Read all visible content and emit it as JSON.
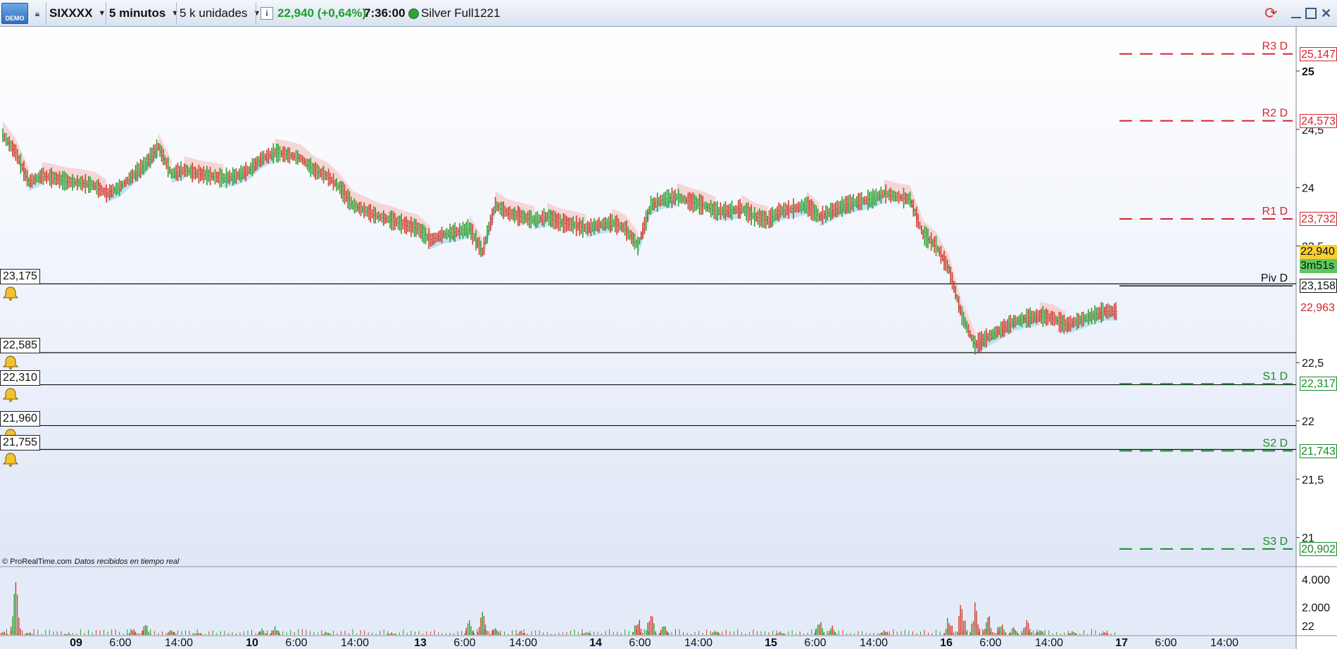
{
  "toolbar": {
    "demo_label": "DEMO",
    "symbol": "SIXXXX",
    "timeframe": "5 minutos",
    "units": "5 k unidades",
    "price_change": "22,940 (+0,64%)",
    "time": "7:36:00",
    "account": "Silver Full1221"
  },
  "chart_data": {
    "type": "line",
    "ylim": [
      20.75,
      25.38
    ],
    "x_tick_labels": [
      "09",
      "6:00",
      "14:00",
      "10",
      "6:00",
      "14:00",
      "13",
      "6:00",
      "14:00",
      "14",
      "6:00",
      "14:00",
      "15",
      "6:00",
      "14:00",
      "16",
      "6:00",
      "14:00",
      "17",
      "6:00",
      "14:00"
    ],
    "y_tick_labels": [
      25,
      24.5,
      24,
      23.5,
      22.5,
      22,
      21.5,
      21
    ],
    "y_tick_text": [
      "25",
      "24,5",
      "24",
      "23,5",
      "22,5",
      "22",
      "21,5",
      "21"
    ],
    "price_series": [
      [
        0,
        24.45
      ],
      [
        2,
        24.3
      ],
      [
        4,
        24.05
      ],
      [
        6,
        24.1
      ],
      [
        8,
        24.08
      ],
      [
        10,
        24.05
      ],
      [
        12,
        24.04
      ],
      [
        14,
        24.02
      ],
      [
        16,
        23.95
      ],
      [
        18,
        24.0
      ],
      [
        20,
        24.1
      ],
      [
        22,
        24.2
      ],
      [
        24,
        24.35
      ],
      [
        26,
        24.12
      ],
      [
        28,
        24.15
      ],
      [
        30,
        24.12
      ],
      [
        32,
        24.1
      ],
      [
        34,
        24.08
      ],
      [
        36,
        24.1
      ],
      [
        38,
        24.15
      ],
      [
        40,
        24.25
      ],
      [
        42,
        24.3
      ],
      [
        44,
        24.28
      ],
      [
        46,
        24.25
      ],
      [
        48,
        24.15
      ],
      [
        50,
        24.1
      ],
      [
        52,
        24.0
      ],
      [
        54,
        23.85
      ],
      [
        56,
        23.8
      ],
      [
        58,
        23.75
      ],
      [
        60,
        23.72
      ],
      [
        62,
        23.68
      ],
      [
        64,
        23.65
      ],
      [
        66,
        23.55
      ],
      [
        68,
        23.6
      ],
      [
        70,
        23.62
      ],
      [
        72,
        23.65
      ],
      [
        74,
        23.45
      ],
      [
        76,
        23.85
      ],
      [
        78,
        23.78
      ],
      [
        80,
        23.75
      ],
      [
        82,
        23.72
      ],
      [
        84,
        23.75
      ],
      [
        86,
        23.7
      ],
      [
        88,
        23.68
      ],
      [
        90,
        23.65
      ],
      [
        92,
        23.68
      ],
      [
        94,
        23.7
      ],
      [
        96,
        23.65
      ],
      [
        98,
        23.5
      ],
      [
        100,
        23.85
      ],
      [
        102,
        23.9
      ],
      [
        104,
        23.92
      ],
      [
        106,
        23.88
      ],
      [
        108,
        23.85
      ],
      [
        110,
        23.8
      ],
      [
        112,
        23.8
      ],
      [
        114,
        23.82
      ],
      [
        116,
        23.75
      ],
      [
        118,
        23.72
      ],
      [
        120,
        23.8
      ],
      [
        122,
        23.82
      ],
      [
        124,
        23.85
      ],
      [
        126,
        23.75
      ],
      [
        128,
        23.8
      ],
      [
        130,
        23.85
      ],
      [
        132,
        23.88
      ],
      [
        134,
        23.9
      ],
      [
        136,
        23.95
      ],
      [
        138,
        23.92
      ],
      [
        140,
        23.9
      ],
      [
        142,
        23.6
      ],
      [
        144,
        23.5
      ],
      [
        146,
        23.3
      ],
      [
        148,
        22.9
      ],
      [
        150,
        22.65
      ],
      [
        152,
        22.72
      ],
      [
        154,
        22.78
      ],
      [
        156,
        22.85
      ],
      [
        158,
        22.88
      ],
      [
        160,
        22.9
      ],
      [
        162,
        22.88
      ],
      [
        164,
        22.82
      ],
      [
        166,
        22.86
      ],
      [
        168,
        22.9
      ],
      [
        170,
        22.94
      ],
      [
        172,
        22.94
      ]
    ],
    "volume_series": [
      [
        0,
        300
      ],
      [
        2,
        3800
      ],
      [
        4,
        200
      ],
      [
        10,
        100
      ],
      [
        20,
        600
      ],
      [
        22,
        900
      ],
      [
        26,
        500
      ],
      [
        30,
        200
      ],
      [
        40,
        500
      ],
      [
        42,
        700
      ],
      [
        50,
        300
      ],
      [
        60,
        200
      ],
      [
        72,
        1100
      ],
      [
        74,
        1900
      ],
      [
        76,
        800
      ],
      [
        80,
        300
      ],
      [
        90,
        300
      ],
      [
        98,
        1500
      ],
      [
        100,
        2200
      ],
      [
        102,
        900
      ],
      [
        110,
        400
      ],
      [
        120,
        300
      ],
      [
        126,
        1300
      ],
      [
        128,
        700
      ],
      [
        136,
        500
      ],
      [
        146,
        1600
      ],
      [
        148,
        2800
      ],
      [
        150,
        2600
      ],
      [
        152,
        1700
      ],
      [
        154,
        1200
      ],
      [
        156,
        600
      ],
      [
        158,
        1300
      ],
      [
        160,
        500
      ],
      [
        165,
        300
      ],
      [
        170,
        200
      ]
    ],
    "volume_ylim": [
      0,
      4500
    ],
    "volume_tick_labels": [
      "4.000",
      "2.000"
    ],
    "volume_last": "22"
  },
  "levels": {
    "alert_lines": [
      {
        "label": "23,175",
        "value": 23.175
      },
      {
        "label": "22,585",
        "value": 22.585
      },
      {
        "label": "22,310",
        "value": 22.31
      },
      {
        "label": "21,960",
        "value": 21.96
      },
      {
        "label": "21,755",
        "value": 21.755
      }
    ],
    "pivots": [
      {
        "name": "R3 D",
        "value": 25.147,
        "label": "25,147",
        "color": "#d0252f"
      },
      {
        "name": "R2 D",
        "value": 24.573,
        "label": "24,573",
        "color": "#d0252f"
      },
      {
        "name": "R1 D",
        "value": 23.732,
        "label": "23,732",
        "color": "#d0252f"
      },
      {
        "name": "Piv D",
        "value": 23.158,
        "label": "23,158",
        "color": "#111111"
      },
      {
        "name": "S1 D",
        "value": 22.317,
        "label": "22,317",
        "color": "#1a8a2a"
      },
      {
        "name": "S2 D",
        "value": 21.743,
        "label": "21,743",
        "color": "#1a8a2a"
      },
      {
        "name": "S3 D",
        "value": 20.902,
        "label": "20,902",
        "color": "#1a8a2a"
      }
    ],
    "hidden_label": "22,963",
    "current_price": "22,940",
    "countdown": "3m51s"
  },
  "footer": {
    "credit": "© ProRealTime.com",
    "realtime_note": "Datos recibidos en tiempo real"
  },
  "colors": {
    "up": "#2e9e2e",
    "down": "#d23a2a",
    "cloud_pos": "#a8dcf2",
    "cloud_neg": "#f6c9c9",
    "current_bg": "#f7cf32",
    "countdown_bg": "#5ec85e"
  }
}
